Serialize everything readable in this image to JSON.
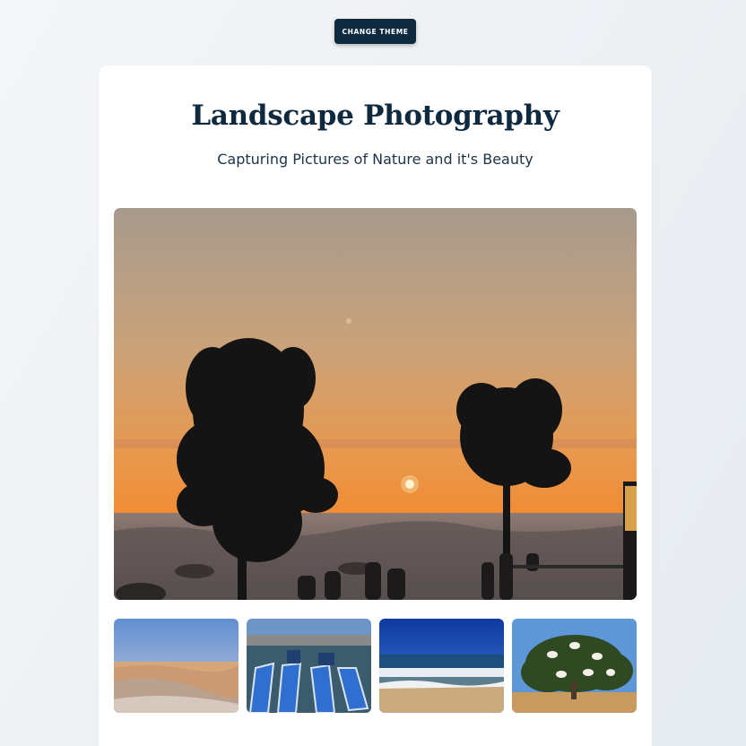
{
  "theme_button": {
    "label": "CHANGE THEME"
  },
  "header": {
    "title": "Landscape Photography",
    "subtitle": "Capturing Pictures of Nature and it's Beauty"
  },
  "main_photo": {
    "description_icon": "sunset-trees-photo"
  },
  "thumbnails": [
    {
      "icon": "desert-dunes-photo"
    },
    {
      "icon": "blue-boats-harbor-photo"
    },
    {
      "icon": "ocean-beach-waves-photo"
    },
    {
      "icon": "goats-in-tree-photo"
    }
  ]
}
